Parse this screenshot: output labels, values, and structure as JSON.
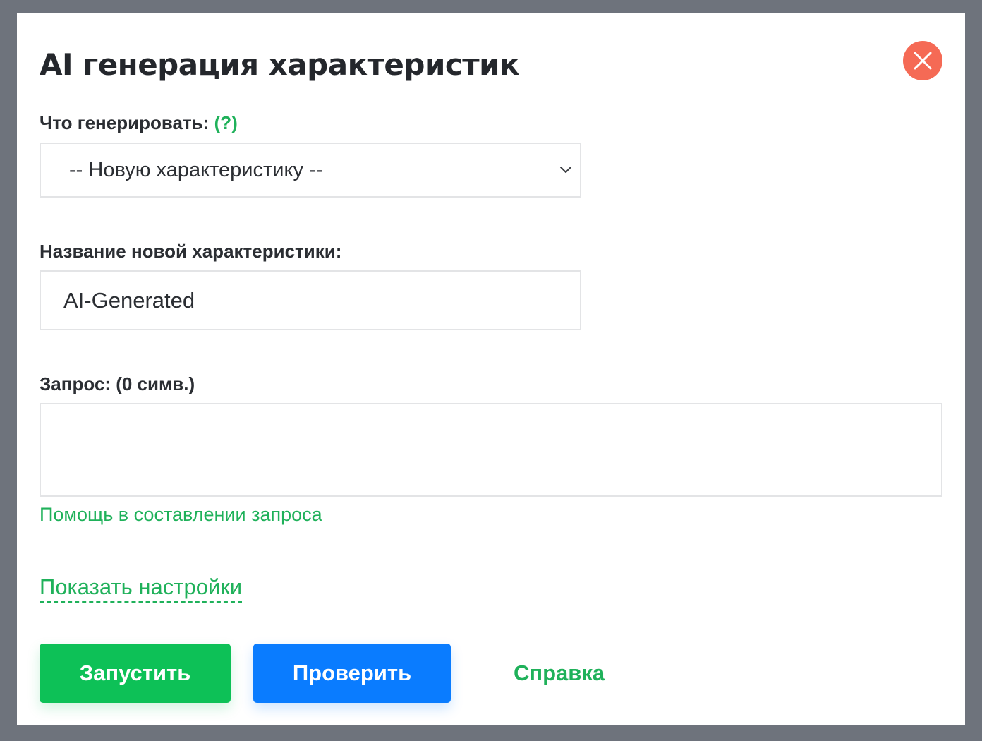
{
  "dialog": {
    "title": "AI генерация характеристик",
    "close_icon": "close-icon"
  },
  "what_to_generate": {
    "label": "Что генерировать:",
    "help_label": "(?)",
    "selected_value": "-- Новую характеристику --"
  },
  "new_characteristic_name": {
    "label": "Название новой характеристики:",
    "value": "AI-Generated"
  },
  "query": {
    "label": "Запрос: (0 симв.)",
    "value": "",
    "help_link": "Помощь в составлении запроса"
  },
  "show_settings_link": "Показать настройки",
  "buttons": {
    "run": "Запустить",
    "check": "Проверить",
    "help": "Справка"
  },
  "colors": {
    "accent_green": "#0dc157",
    "link_green": "#1fb15a",
    "primary_blue": "#0a7cff",
    "close_red": "#f56a55"
  }
}
